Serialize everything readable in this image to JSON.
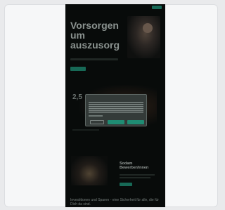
{
  "page": {
    "background": "#e9eaec",
    "card_background": "#f6f7f8",
    "phone_background": "#0b0f0e",
    "accent": "#1f8c73"
  },
  "hero": {
    "title_lines": [
      "Vorsorgen",
      "um",
      "auszusorg"
    ]
  },
  "section2": {
    "number": "2,5"
  },
  "section3": {
    "title_lines": [
      "Sodam",
      "Bewerber/innen"
    ]
  },
  "bottom": {
    "text": "Investitionen und Sparen - eine Sicherheit für alle, die für Dich da sind."
  },
  "consent_dialog": {
    "icons": [
      "cookie-dialog"
    ]
  }
}
